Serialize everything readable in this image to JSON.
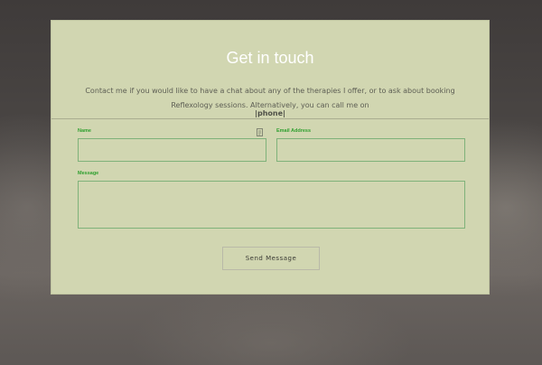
{
  "contact": {
    "title": "Get in touch",
    "intro": "Contact me if you would like to have a chat about any of the therapies I offer, or to ask about booking Reflexology sessions. Alternatively, you can call me on",
    "phone": "|phone|"
  },
  "form": {
    "name_label": "Name",
    "email_label": "Email Address",
    "message_label": "Message",
    "name_value": "",
    "email_value": "",
    "message_value": "",
    "send_label": "Send Message"
  },
  "colors": {
    "card_bg": "#d1d6b1",
    "label_green": "#2e9f2e",
    "field_border": "#7fb27a"
  },
  "icons": {
    "name_field_icon": "contact-card-icon"
  }
}
